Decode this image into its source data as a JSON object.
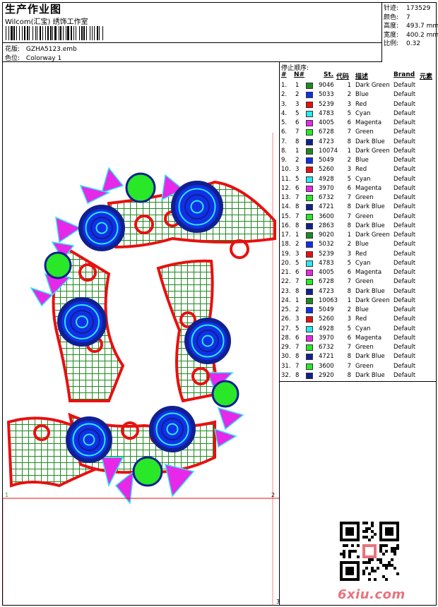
{
  "header": {
    "title": "生产作业图",
    "software": "Wilcom(汇宝) 绣饰工作室",
    "design_label": "花版:",
    "design_value": "GZHA5123.emb",
    "colorway_label": "色位:",
    "colorway_value": "Colorway 1"
  },
  "stats": [
    {
      "label": "针迹:",
      "value": "173529"
    },
    {
      "label": "颜色:",
      "value": "7"
    },
    {
      "label": "高度:",
      "value": "493.7 mm"
    },
    {
      "label": "宽度:",
      "value": "400.2 mm"
    },
    {
      "label": "比例:",
      "value": "0.32"
    }
  ],
  "sequence": {
    "title": "停止顺序:",
    "headers": {
      "num": "#",
      "n": "N#",
      "st": "St.",
      "code": "代码",
      "desc": "描述",
      "brand": "Brand",
      "elem": "元素"
    },
    "rows": [
      {
        "num": "1.",
        "n": "1",
        "st": "9046",
        "code": "1",
        "desc": "Dark Green",
        "brand": "Default",
        "color": "#1e8a1e"
      },
      {
        "num": "2.",
        "n": "2",
        "st": "5033",
        "code": "2",
        "desc": "Blue",
        "brand": "Default",
        "color": "#1030e8"
      },
      {
        "num": "3.",
        "n": "3",
        "st": "5239",
        "code": "3",
        "desc": "Red",
        "brand": "Default",
        "color": "#e81010"
      },
      {
        "num": "4.",
        "n": "5",
        "st": "4783",
        "code": "5",
        "desc": "Cyan",
        "brand": "Default",
        "color": "#28e8f0"
      },
      {
        "num": "5.",
        "n": "6",
        "st": "4005",
        "code": "6",
        "desc": "Magenta",
        "brand": "Default",
        "color": "#e828e8"
      },
      {
        "num": "6.",
        "n": "7",
        "st": "6728",
        "code": "7",
        "desc": "Green",
        "brand": "Default",
        "color": "#28e828"
      },
      {
        "num": "7.",
        "n": "8",
        "st": "4723",
        "code": "8",
        "desc": "Dark Blue",
        "brand": "Default",
        "color": "#102090"
      },
      {
        "num": "8.",
        "n": "1",
        "st": "10074",
        "code": "1",
        "desc": "Dark Green",
        "brand": "Default",
        "color": "#1e8a1e"
      },
      {
        "num": "9.",
        "n": "2",
        "st": "5049",
        "code": "2",
        "desc": "Blue",
        "brand": "Default",
        "color": "#1030e8"
      },
      {
        "num": "10.",
        "n": "3",
        "st": "5260",
        "code": "3",
        "desc": "Red",
        "brand": "Default",
        "color": "#e81010"
      },
      {
        "num": "11.",
        "n": "5",
        "st": "4928",
        "code": "5",
        "desc": "Cyan",
        "brand": "Default",
        "color": "#28e8f0"
      },
      {
        "num": "12.",
        "n": "6",
        "st": "3970",
        "code": "6",
        "desc": "Magenta",
        "brand": "Default",
        "color": "#e828e8"
      },
      {
        "num": "13.",
        "n": "7",
        "st": "6732",
        "code": "7",
        "desc": "Green",
        "brand": "Default",
        "color": "#28e828"
      },
      {
        "num": "14.",
        "n": "8",
        "st": "4721",
        "code": "8",
        "desc": "Dark Blue",
        "brand": "Default",
        "color": "#102090"
      },
      {
        "num": "15.",
        "n": "7",
        "st": "3600",
        "code": "7",
        "desc": "Green",
        "brand": "Default",
        "color": "#28e828"
      },
      {
        "num": "16.",
        "n": "8",
        "st": "2863",
        "code": "8",
        "desc": "Dark Blue",
        "brand": "Default",
        "color": "#102090"
      },
      {
        "num": "17.",
        "n": "1",
        "st": "9020",
        "code": "1",
        "desc": "Dark Green",
        "brand": "Default",
        "color": "#1e8a1e"
      },
      {
        "num": "18.",
        "n": "2",
        "st": "5032",
        "code": "2",
        "desc": "Blue",
        "brand": "Default",
        "color": "#1030e8"
      },
      {
        "num": "19.",
        "n": "3",
        "st": "5239",
        "code": "3",
        "desc": "Red",
        "brand": "Default",
        "color": "#e81010"
      },
      {
        "num": "20.",
        "n": "5",
        "st": "4783",
        "code": "5",
        "desc": "Cyan",
        "brand": "Default",
        "color": "#28e8f0"
      },
      {
        "num": "21.",
        "n": "6",
        "st": "4005",
        "code": "6",
        "desc": "Magenta",
        "brand": "Default",
        "color": "#e828e8"
      },
      {
        "num": "22.",
        "n": "7",
        "st": "6728",
        "code": "7",
        "desc": "Green",
        "brand": "Default",
        "color": "#28e828"
      },
      {
        "num": "23.",
        "n": "8",
        "st": "4723",
        "code": "8",
        "desc": "Dark Blue",
        "brand": "Default",
        "color": "#102090"
      },
      {
        "num": "24.",
        "n": "1",
        "st": "10063",
        "code": "1",
        "desc": "Dark Green",
        "brand": "Default",
        "color": "#1e8a1e"
      },
      {
        "num": "25.",
        "n": "2",
        "st": "5049",
        "code": "2",
        "desc": "Blue",
        "brand": "Default",
        "color": "#1030e8"
      },
      {
        "num": "26.",
        "n": "3",
        "st": "5260",
        "code": "3",
        "desc": "Red",
        "brand": "Default",
        "color": "#e81010"
      },
      {
        "num": "27.",
        "n": "5",
        "st": "4928",
        "code": "5",
        "desc": "Cyan",
        "brand": "Default",
        "color": "#28e8f0"
      },
      {
        "num": "28.",
        "n": "6",
        "st": "3970",
        "code": "6",
        "desc": "Magenta",
        "brand": "Default",
        "color": "#e828e8"
      },
      {
        "num": "29.",
        "n": "7",
        "st": "6732",
        "code": "7",
        "desc": "Green",
        "brand": "Default",
        "color": "#28e828"
      },
      {
        "num": "30.",
        "n": "8",
        "st": "4721",
        "code": "8",
        "desc": "Dark Blue",
        "brand": "Default",
        "color": "#102090"
      },
      {
        "num": "31.",
        "n": "7",
        "st": "3600",
        "code": "7",
        "desc": "Green",
        "brand": "Default",
        "color": "#28e828"
      },
      {
        "num": "32.",
        "n": "8",
        "st": "2920",
        "code": "8",
        "desc": "Dark Blue",
        "brand": "Default",
        "color": "#102090"
      }
    ]
  },
  "markers": {
    "one": "1",
    "two": "2",
    "three": "3"
  },
  "watermark": "6xiu.com",
  "colors": {
    "dark_green": "#1e8a1e",
    "blue": "#1030e8",
    "red": "#e81010",
    "cyan": "#28e8f0",
    "magenta": "#e828e8",
    "green": "#28e828",
    "dark_blue": "#102090"
  }
}
